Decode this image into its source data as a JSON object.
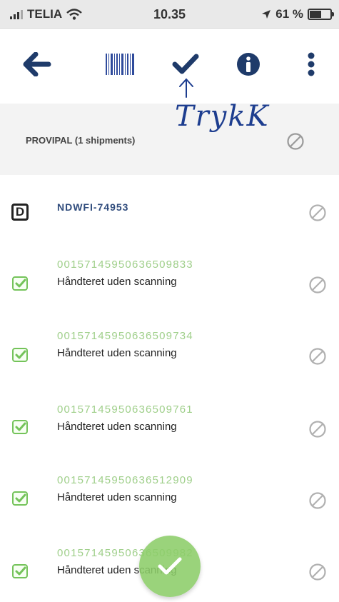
{
  "status_bar": {
    "carrier": "TELIA",
    "time": "10.35",
    "battery": "61 %",
    "battery_level": 0.61
  },
  "toolbar": {
    "icons": [
      "back-arrow-icon",
      "barcode-icon",
      "checkmark-icon",
      "info-icon",
      "more-vertical-icon"
    ]
  },
  "annotation": {
    "text": "TrykK"
  },
  "group": {
    "title": "PROVIPAL (1 shipments)"
  },
  "shipment": {
    "badge": "D",
    "id": "NDWFI-74953"
  },
  "items": [
    {
      "barcode": "00157145950636509833",
      "status": "Håndteret uden scanning"
    },
    {
      "barcode": "00157145950636509734",
      "status": "Håndteret uden scanning"
    },
    {
      "barcode": "00157145950636509761",
      "status": "Håndteret uden scanning"
    },
    {
      "barcode": "00157145950636512909",
      "status": "Håndteret uden scanning"
    },
    {
      "barcode": "00157145950636509982",
      "status": "Håndteret uden scanning"
    }
  ],
  "colors": {
    "primary": "#1f3b6a",
    "green": "#74c35a",
    "annotation": "#1d3d8f"
  }
}
